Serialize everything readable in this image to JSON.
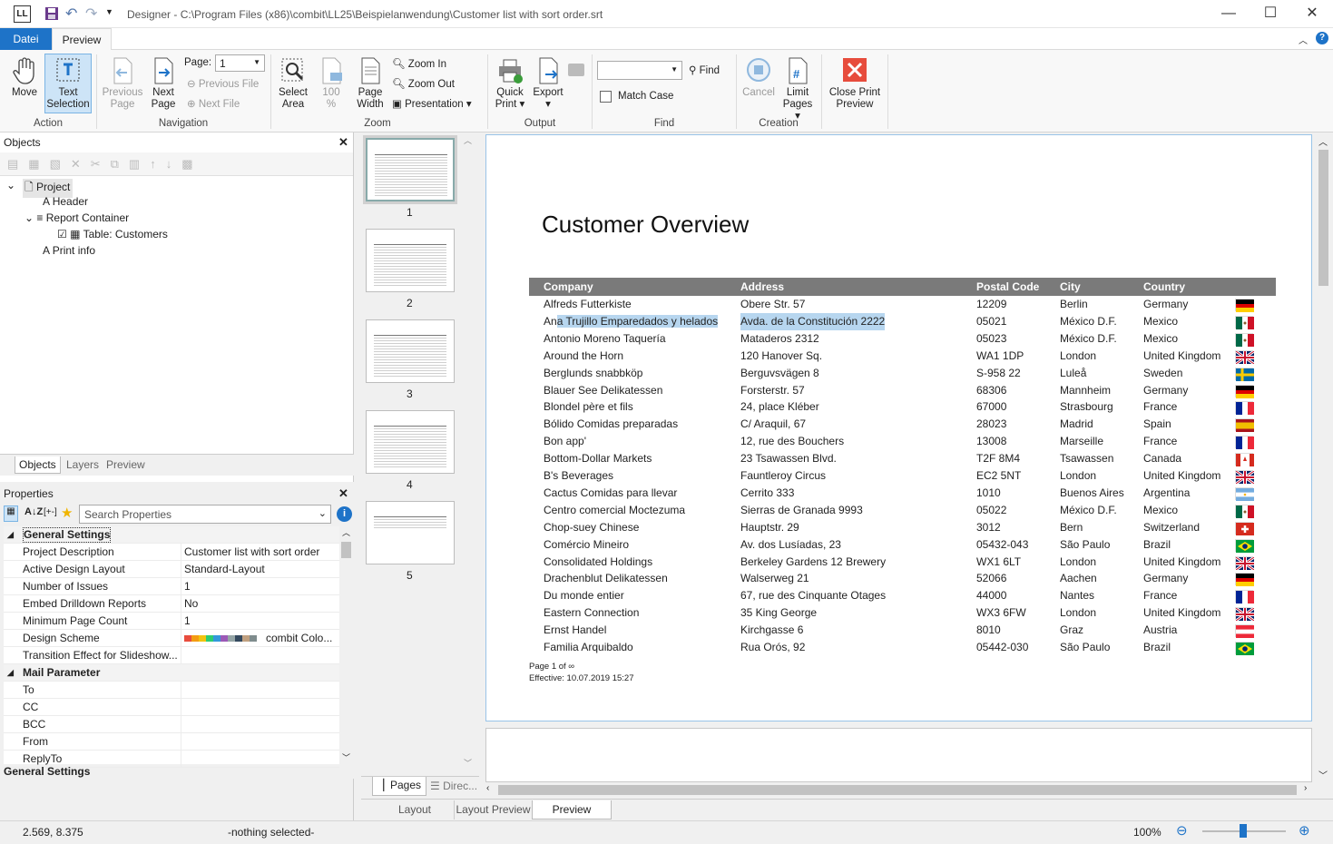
{
  "titlebar": {
    "logo": "LL",
    "title": "Designer - C:\\Program Files (x86)\\combit\\LL25\\Beispielanwendung\\Customer list with sort order.srt",
    "minimize": "—",
    "maximize": "☐",
    "close": "✕"
  },
  "tabs": {
    "file": "Datei",
    "preview": "Preview"
  },
  "ribbon": {
    "move": "Move",
    "text_selection_1": "Text",
    "text_selection_2": "Selection",
    "group_action": "Action",
    "previous_page_1": "Previous",
    "previous_page_2": "Page",
    "next_page_1": "Next",
    "next_page_2": "Page",
    "page_label": "Page:",
    "page_value": "1",
    "previous_file": "Previous File",
    "next_file": "Next File",
    "group_navigation": "Navigation",
    "select_area_1": "Select",
    "select_area_2": "Area",
    "zoom100_1": "100",
    "zoom100_2": "%",
    "page_width_1": "Page",
    "page_width_2": "Width",
    "zoom_in": "Zoom In",
    "zoom_out": "Zoom Out",
    "presentation": "Presentation",
    "group_zoom": "Zoom",
    "quick_print_1": "Quick",
    "quick_print_2": "Print",
    "export": "Export",
    "group_output": "Output",
    "find": "Find",
    "match_case": "Match Case",
    "group_find": "Find",
    "cancel": "Cancel",
    "limit_pages_1": "Limit",
    "limit_pages_2": "Pages",
    "group_creation": "Creation",
    "close_preview_1": "Close Print",
    "close_preview_2": "Preview"
  },
  "objects": {
    "title": "Objects",
    "tree": [
      "Project",
      "Header",
      "Report Container",
      "Table: Customers",
      "Print info"
    ],
    "tabs": [
      "Objects",
      "Layers",
      "Preview"
    ]
  },
  "properties": {
    "title": "Properties",
    "search_placeholder": "Search Properties",
    "plusminus": "[+-]",
    "sections": [
      "General Settings",
      "Mail Parameter"
    ],
    "general": [
      {
        "k": "Project Description",
        "v": "Customer list with sort order"
      },
      {
        "k": "Active Design Layout",
        "v": "Standard-Layout"
      },
      {
        "k": "Number of Issues",
        "v": "1"
      },
      {
        "k": "Embed Drilldown Reports",
        "v": "No"
      },
      {
        "k": "Minimum Page Count",
        "v": "1"
      },
      {
        "k": "Design Scheme",
        "v": "combit Colo..."
      },
      {
        "k": "Transition Effect for Slideshow...",
        "v": ""
      }
    ],
    "mail": [
      {
        "k": "To",
        "v": ""
      },
      {
        "k": "CC",
        "v": ""
      },
      {
        "k": "BCC",
        "v": ""
      },
      {
        "k": "From",
        "v": ""
      },
      {
        "k": "ReplyTo",
        "v": ""
      }
    ],
    "footer": "General Settings"
  },
  "scheme_colors": [
    "#e84c3d",
    "#f39c12",
    "#f1c40f",
    "#2ecc71",
    "#3498db",
    "#9b59b6",
    "#95a5a6",
    "#34495e",
    "#c0a080",
    "#7f8c8d"
  ],
  "pages": {
    "numbers": [
      "1",
      "2",
      "3",
      "4",
      "5"
    ],
    "tab_pages": "Pages",
    "tab_direc": "Direc..."
  },
  "document": {
    "title": "Customer Overview",
    "headers": [
      "Company",
      "Address",
      "Postal Code",
      "City",
      "Country"
    ],
    "rows": [
      [
        "Alfreds Futterkiste",
        "Obere Str. 57",
        "12209",
        "Berlin",
        "Germany",
        "de"
      ],
      [
        "Ana Trujillo Emparedados y helados",
        "Avda. de la Constitución 2222",
        "05021",
        "México D.F.",
        "Mexico",
        "mx"
      ],
      [
        "Antonio Moreno Taquería",
        "Mataderos 2312",
        "05023",
        "México D.F.",
        "Mexico",
        "mx"
      ],
      [
        "Around the Horn",
        "120 Hanover Sq.",
        "WA1 1DP",
        "London",
        "United Kingdom",
        "uk"
      ],
      [
        "Berglunds snabbköp",
        "Berguvsvägen 8",
        "S-958 22",
        "Luleå",
        "Sweden",
        "se"
      ],
      [
        "Blauer See Delikatessen",
        "Forsterstr. 57",
        "68306",
        "Mannheim",
        "Germany",
        "de"
      ],
      [
        "Blondel père et fils",
        "24, place Kléber",
        "67000",
        "Strasbourg",
        "France",
        "fr"
      ],
      [
        "Bólido Comidas preparadas",
        "C/ Araquil, 67",
        "28023",
        "Madrid",
        "Spain",
        "es"
      ],
      [
        "Bon app'",
        "12, rue des Bouchers",
        "13008",
        "Marseille",
        "France",
        "fr"
      ],
      [
        "Bottom-Dollar Markets",
        "23 Tsawassen Blvd.",
        "T2F 8M4",
        "Tsawassen",
        "Canada",
        "ca"
      ],
      [
        "B's Beverages",
        "Fauntleroy Circus",
        "EC2 5NT",
        "London",
        "United Kingdom",
        "uk"
      ],
      [
        "Cactus Comidas para llevar",
        "Cerrito 333",
        "1010",
        "Buenos Aires",
        "Argentina",
        "ar"
      ],
      [
        "Centro comercial Moctezuma",
        "Sierras de Granada 9993",
        "05022",
        "México D.F.",
        "Mexico",
        "mx"
      ],
      [
        "Chop-suey Chinese",
        "Hauptstr. 29",
        "3012",
        "Bern",
        "Switzerland",
        "ch"
      ],
      [
        "Comércio Mineiro",
        "Av. dos Lusíadas, 23",
        "05432-043",
        "São Paulo",
        "Brazil",
        "br"
      ],
      [
        "Consolidated Holdings",
        "Berkeley Gardens 12 Brewery",
        "WX1 6LT",
        "London",
        "United Kingdom",
        "uk"
      ],
      [
        "Drachenblut Delikatessen",
        "Walserweg 21",
        "52066",
        "Aachen",
        "Germany",
        "de"
      ],
      [
        "Du monde entier",
        "67, rue des Cinquante Otages",
        "44000",
        "Nantes",
        "France",
        "fr"
      ],
      [
        "Eastern Connection",
        "35 King George",
        "WX3 6FW",
        "London",
        "United Kingdom",
        "uk"
      ],
      [
        "Ernst Handel",
        "Kirchgasse 6",
        "8010",
        "Graz",
        "Austria",
        "at"
      ],
      [
        "Familia Arquibaldo",
        "Rua Orós, 92",
        "05442-030",
        "São Paulo",
        "Brazil",
        "br"
      ]
    ],
    "footer1": "Page 1 of ∞",
    "footer2": "Effective: 10.07.2019 15:27"
  },
  "bottom_tabs": [
    "Layout",
    "Layout Preview",
    "Preview"
  ],
  "status": {
    "coords": "2.569, 8.375",
    "selection": "-nothing selected-",
    "zoom": "100%"
  }
}
